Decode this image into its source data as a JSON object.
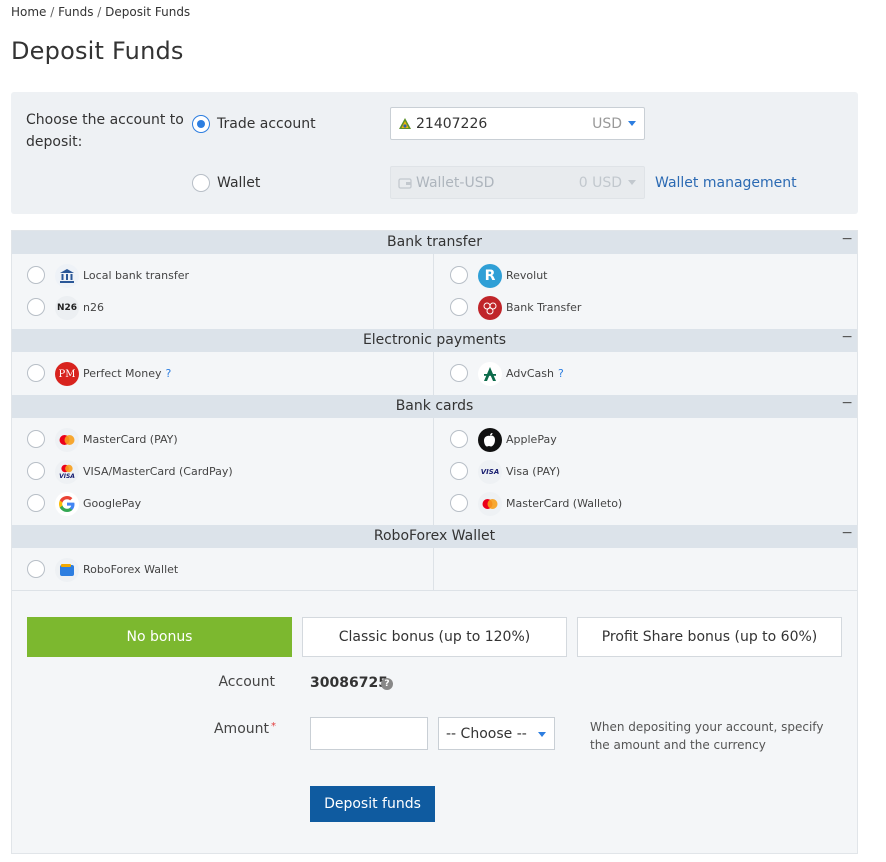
{
  "breadcrumb": {
    "home": "Home",
    "funds": "Funds",
    "current": "Deposit Funds",
    "sep": "/"
  },
  "page_title": "Deposit Funds",
  "account_chooser": {
    "label": "Choose the account to deposit:",
    "trade_label": "Trade account",
    "trade_number": "21407226",
    "trade_currency": "USD",
    "wallet_label": "Wallet",
    "wallet_name": "Wallet-USD",
    "wallet_balance": "0 USD",
    "wallet_management": "Wallet management"
  },
  "sections": {
    "bank_transfer": "Bank transfer",
    "electronic": "Electronic payments",
    "bank_cards": "Bank cards",
    "roboforex_wallet": "RoboForex Wallet",
    "collapse": "−"
  },
  "methods": {
    "local_bank": "Local bank transfer",
    "revolut": "Revolut",
    "n26": "n26",
    "bank_transfer": "Bank Transfer",
    "perfect_money": "Perfect Money",
    "advcash": "AdvCash",
    "mastercard_pay": "MasterCard (PAY)",
    "applepay": "ApplePay",
    "visa_mc_cardpay": "VISA/MasterCard (CardPay)",
    "visa_pay": "Visa (PAY)",
    "googlepay": "GooglePay",
    "mastercard_walleto": "MasterCard (Walleto)",
    "rf_wallet": "RoboForex Wallet",
    "help_mark": "?"
  },
  "logos": {
    "n26": "N26",
    "pm": "PM",
    "revolut": "R",
    "visa": "VISA"
  },
  "bonus": {
    "no_bonus": "No bonus",
    "classic": "Classic bonus (up to 120%)",
    "profit_share": "Profit Share bonus (up to 60%)"
  },
  "form": {
    "account_label": "Account",
    "account_value": "30086725",
    "help": "?",
    "amount_label": "Amount",
    "required": "*",
    "amount_value": "",
    "currency_select": "-- Choose --",
    "hint": "When depositing your account, specify the amount and the currency",
    "deposit_button": "Deposit funds"
  },
  "colors": {
    "accent": "#2d7ee0",
    "bonus_active": "#7cb82f",
    "deposit_button": "#0f5ba0",
    "link": "#2b6ab3"
  }
}
